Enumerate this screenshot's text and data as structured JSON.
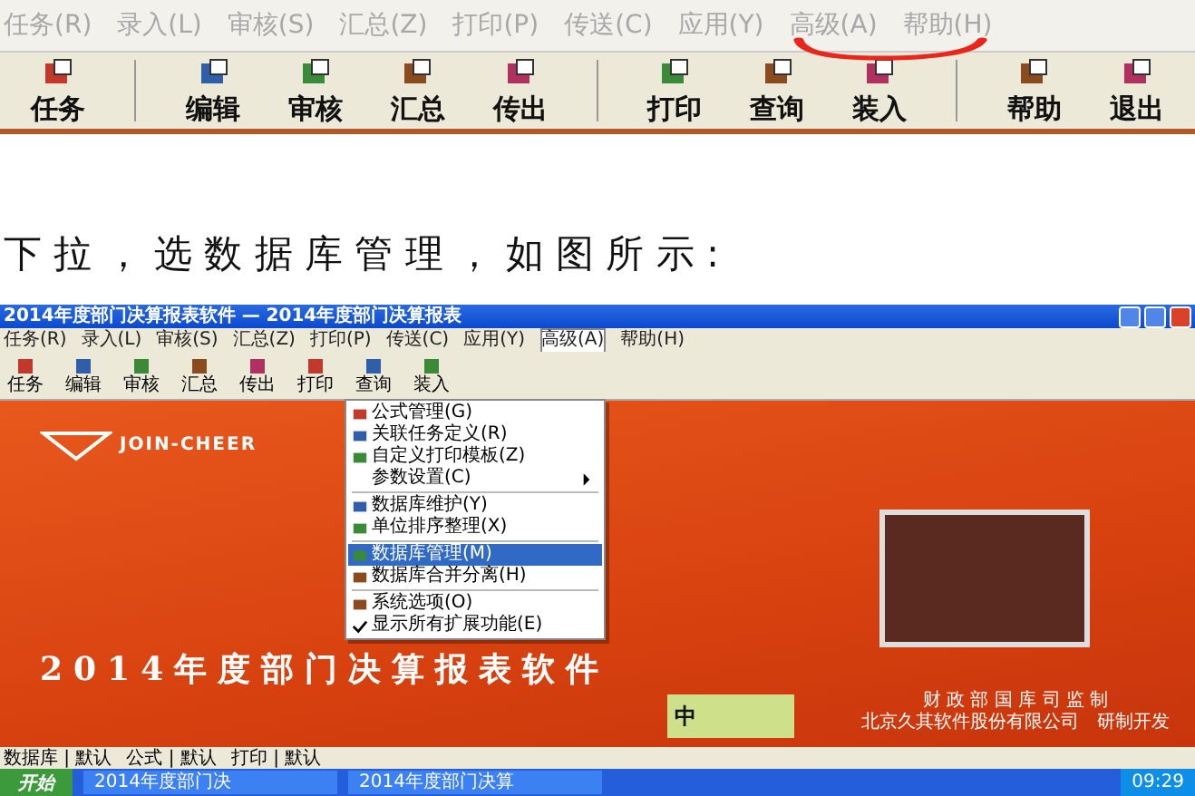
{
  "menu_bar": {
    "items": [
      {
        "label": "任务(R)"
      },
      {
        "label": "录入(L)"
      },
      {
        "label": "审核(S)"
      },
      {
        "label": "汇总(Z)"
      },
      {
        "label": "打印(P)"
      },
      {
        "label": "传送(C)"
      },
      {
        "label": "应用(Y)"
      },
      {
        "label": "高级(A)"
      },
      {
        "label": "帮助(H)"
      }
    ]
  },
  "toolbar": {
    "groups": [
      [
        "任务"
      ],
      [
        "编辑",
        "审核",
        "汇总",
        "传出"
      ],
      [
        "打印",
        "查询",
        "装入"
      ],
      [
        "帮助",
        "退出"
      ]
    ]
  },
  "instruction": "下 拉 ， 选 数 据 库 管 理 ， 如 图 所 示 :",
  "screenshot": {
    "title": "2014年度部门决算报表软件 — 2014年度部门决算报表",
    "menu_items": [
      {
        "label": "任务(R)",
        "selected": false
      },
      {
        "label": "录入(L)",
        "selected": false
      },
      {
        "label": "审核(S)",
        "selected": false
      },
      {
        "label": "汇总(Z)",
        "selected": false
      },
      {
        "label": "打印(P)",
        "selected": false
      },
      {
        "label": "传送(C)",
        "selected": false
      },
      {
        "label": "应用(Y)",
        "selected": false
      },
      {
        "label": "高级(A)",
        "selected": true
      },
      {
        "label": "帮助(H)",
        "selected": false
      }
    ],
    "toolbar_items": [
      "任务",
      "编辑",
      "审核",
      "汇总",
      "传出",
      "打印",
      "查询",
      "装入"
    ],
    "dropdown": [
      [
        {
          "label": "公式管理(G)",
          "kind": "icon",
          "selected": false,
          "has_submenu": false
        },
        {
          "label": "关联任务定义(R)",
          "kind": "icon",
          "selected": false,
          "has_submenu": false
        },
        {
          "label": "自定义打印模板(Z)",
          "kind": "icon",
          "selected": false,
          "has_submenu": false
        },
        {
          "label": "参数设置(C)",
          "kind": "plain",
          "selected": false,
          "has_submenu": true
        }
      ],
      [
        {
          "label": "数据库维护(Y)",
          "kind": "icon",
          "selected": false,
          "has_submenu": false
        },
        {
          "label": "单位排序整理(X)",
          "kind": "icon",
          "selected": false,
          "has_submenu": false
        }
      ],
      [
        {
          "label": "数据库管理(M)",
          "kind": "icon",
          "selected": true,
          "has_submenu": false
        },
        {
          "label": "数据库合并分离(H)",
          "kind": "icon",
          "selected": false,
          "has_submenu": false
        }
      ],
      [
        {
          "label": "系统选项(O)",
          "kind": "icon",
          "selected": false,
          "has_submenu": false
        },
        {
          "label": "显示所有扩展功能(E)",
          "kind": "check",
          "selected": false,
          "has_submenu": false
        }
      ]
    ],
    "logo_text": "JOIN-CHEER",
    "banner_title": "2014年度部门决算报表软件",
    "stamp_text": "中",
    "credits": [
      "财 政 部 国 库 司 监 制",
      "北京久其软件股份有限公司　研制开发"
    ],
    "status_bar": [
      "数据库 | 默认",
      "公式 | 默认",
      "打印 | 默认"
    ],
    "taskbar": {
      "start": "开始",
      "tasks": [
        "2014年度部门决",
        "2014年度部门决算"
      ],
      "clock": "09:29"
    }
  }
}
